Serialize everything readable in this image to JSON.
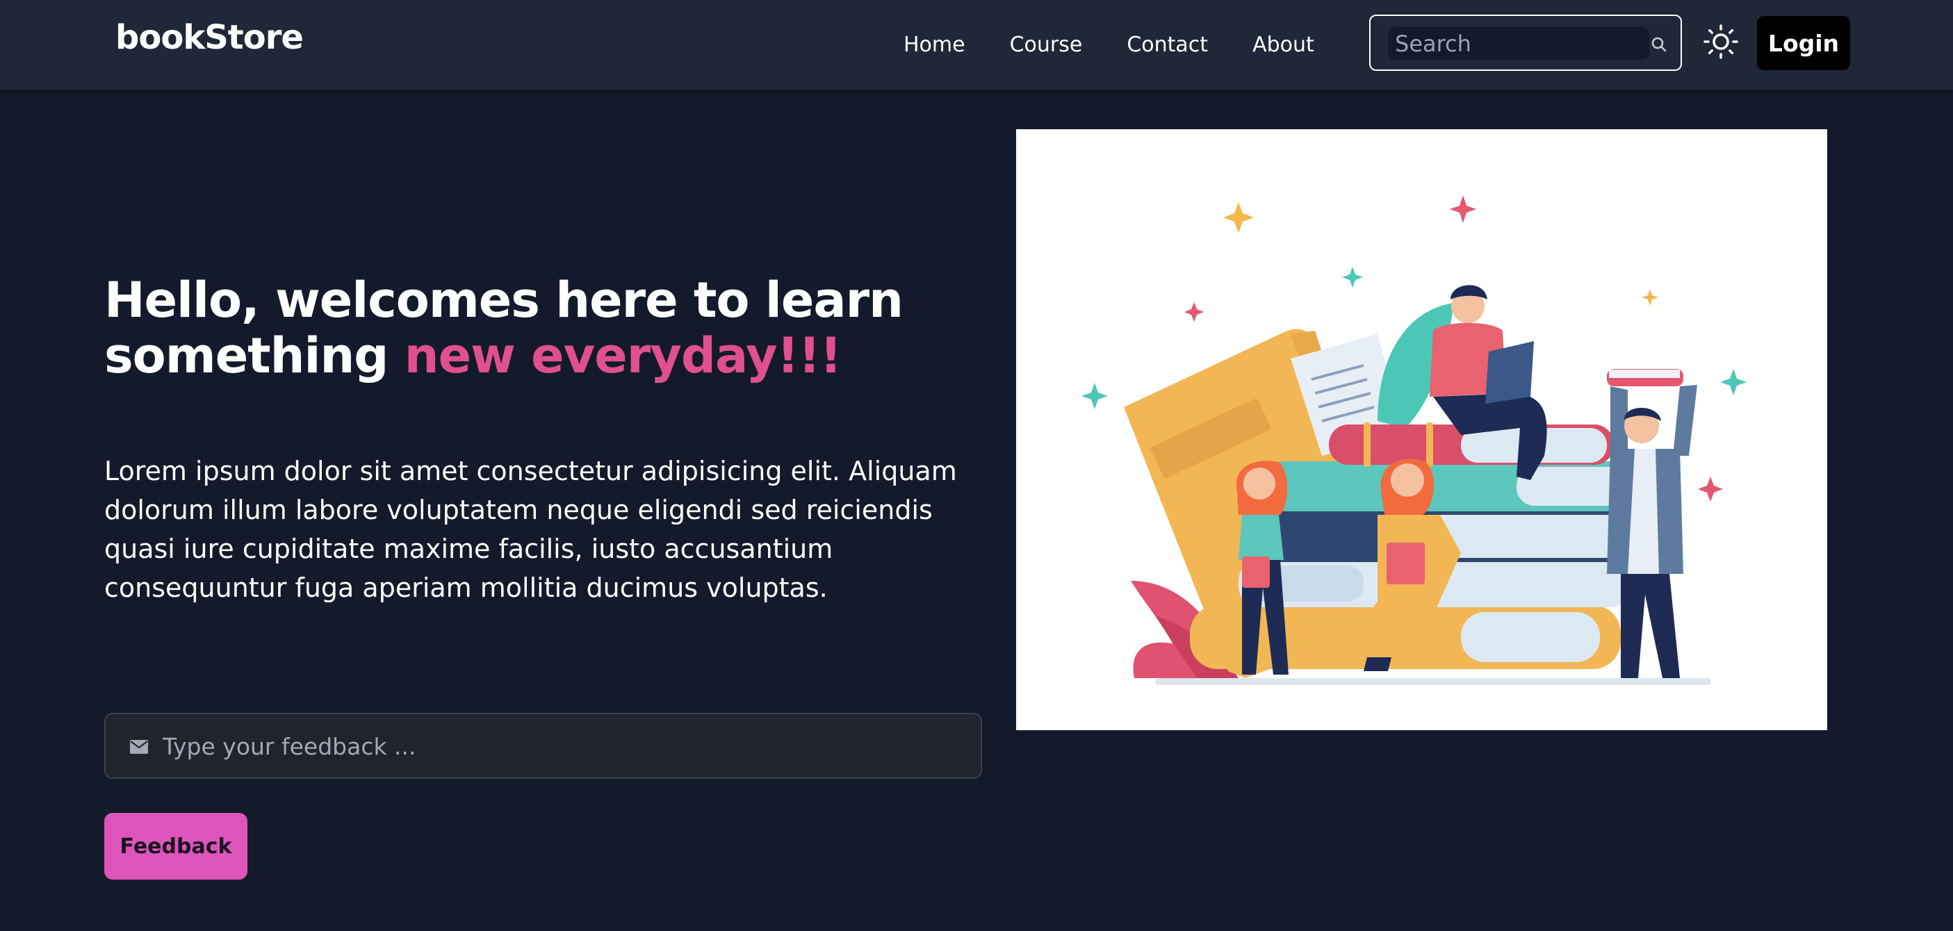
{
  "navbar": {
    "brand": "bookStore",
    "links": [
      "Home",
      "Course",
      "Contact",
      "About"
    ],
    "search_placeholder": "Search",
    "login_label": "Login"
  },
  "hero": {
    "title_main": "Hello, welcomes here to learn something ",
    "title_accent": "new everyday!!!",
    "description": "Lorem ipsum dolor sit amet consectetur adipisicing elit. Aliquam dolorum illum labore voluptatem neque eligendi sed reiciendis quasi iure cupiditate maxime facilis, iusto accusantium consequuntur fuga aperiam mollitia ducimus voluptas.",
    "feedback_placeholder": "Type your feedback ...",
    "feedback_button": "Feedback"
  },
  "colors": {
    "background": "#141a2b",
    "navbar": "#1f2738",
    "accent": "#e0508f",
    "button": "#dd55bb"
  },
  "icons": {
    "search": "search-icon",
    "theme": "sun-icon",
    "mail": "envelope-icon"
  }
}
